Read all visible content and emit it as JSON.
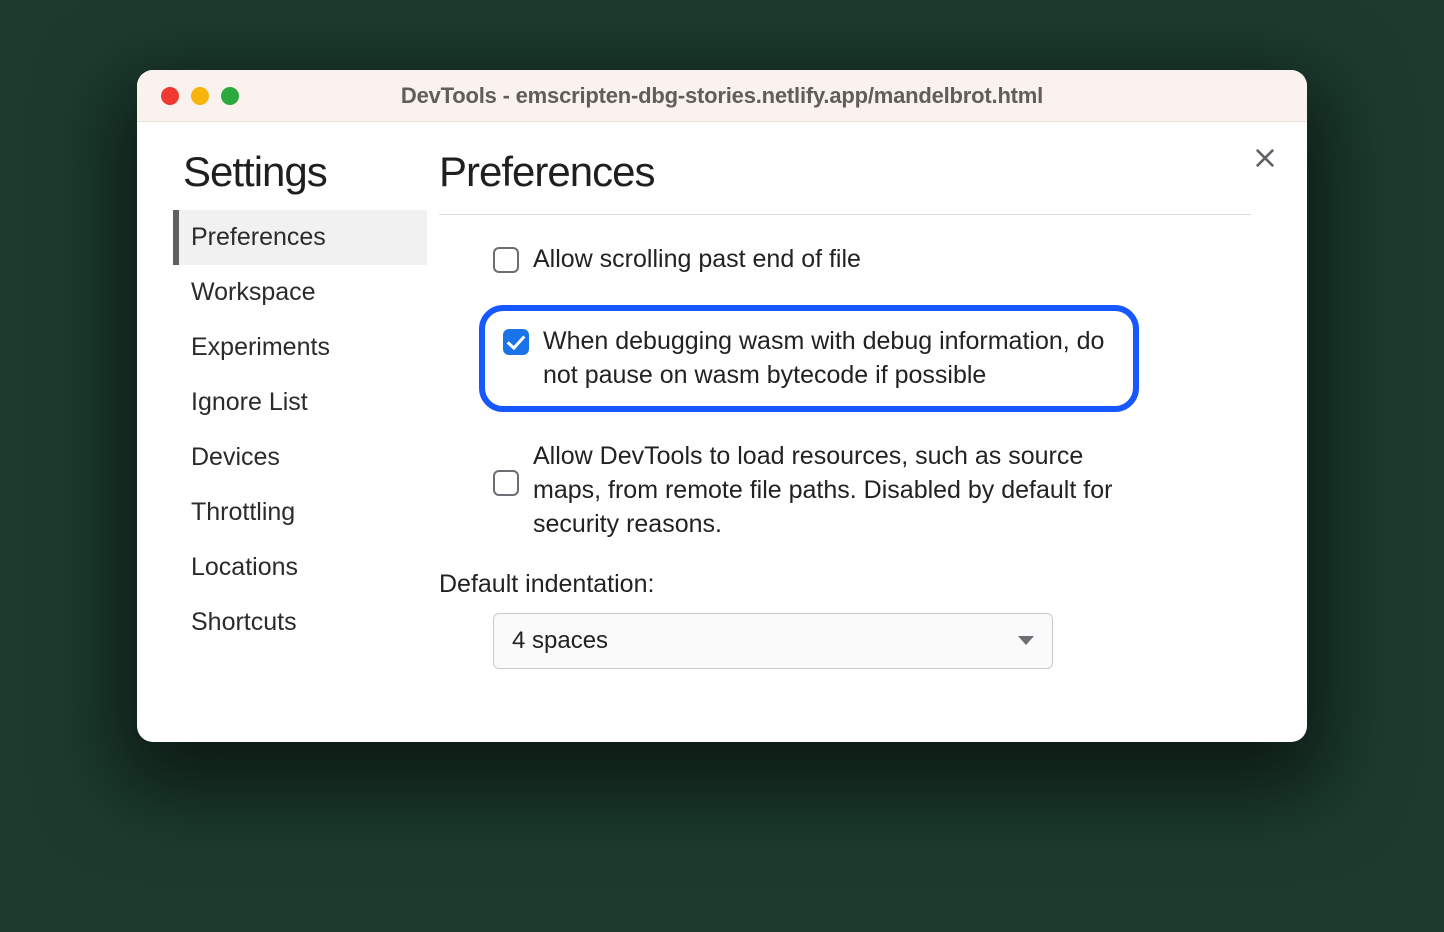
{
  "window": {
    "title": "DevTools - emscripten-dbg-stories.netlify.app/mandelbrot.html"
  },
  "sidebar": {
    "heading": "Settings",
    "items": [
      {
        "label": "Preferences",
        "active": true
      },
      {
        "label": "Workspace"
      },
      {
        "label": "Experiments"
      },
      {
        "label": "Ignore List"
      },
      {
        "label": "Devices"
      },
      {
        "label": "Throttling"
      },
      {
        "label": "Locations"
      },
      {
        "label": "Shortcuts"
      }
    ]
  },
  "main": {
    "heading": "Preferences",
    "options": [
      {
        "label": "Allow scrolling past end of file",
        "checked": false,
        "highlight": false
      },
      {
        "label": "When debugging wasm with debug information, do not pause on wasm bytecode if possible",
        "checked": true,
        "highlight": true
      },
      {
        "label": "Allow DevTools to load resources, such as source maps, from remote file paths. Disabled by default for security reasons.",
        "checked": false,
        "highlight": false
      }
    ],
    "indentation": {
      "label": "Default indentation:",
      "value": "4 spaces"
    }
  }
}
